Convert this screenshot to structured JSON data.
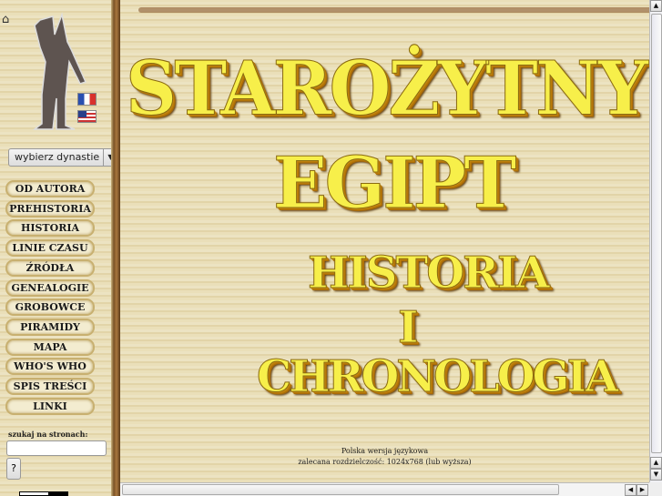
{
  "sidebar": {
    "dynasty_select": "wybierz dynastie",
    "nav": [
      "OD AUTORA",
      "PREHISTORIA",
      "HISTORIA",
      "LINIE CZASU",
      "ŹRÓDŁA",
      "GENEALOGIE",
      "GROBOWCE",
      "PIRAMIDY",
      "MAPA",
      "WHO'S WHO",
      "SPIS TREŚCI",
      "LINKI"
    ],
    "search_label": "szukaj na stronach:",
    "search_value": "",
    "search_button": "?"
  },
  "main": {
    "title_lines": [
      "STAROŻYTNY",
      "EGIPT",
      "HISTORIA",
      "I",
      "CHRONOLOGIA"
    ],
    "footer_line1": "Polska wersja językowa",
    "footer_line2": "zalecana rozdzielczość: 1024x768 (lub wyższa)"
  }
}
